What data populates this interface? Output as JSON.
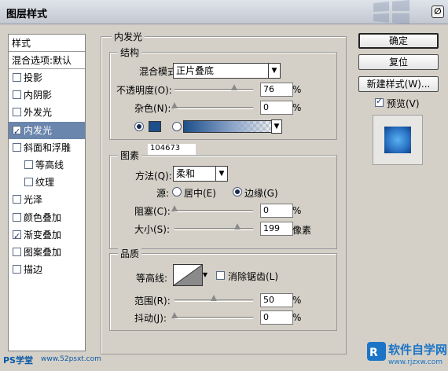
{
  "window": {
    "title": "图层样式",
    "close_glyph": "∅"
  },
  "style_list": {
    "header": "样式",
    "blend_options": "混合选项:默认",
    "items": [
      {
        "label": "投影",
        "checked": false,
        "indent": false,
        "selected": false
      },
      {
        "label": "内阴影",
        "checked": false,
        "indent": false,
        "selected": false
      },
      {
        "label": "外发光",
        "checked": false,
        "indent": false,
        "selected": false
      },
      {
        "label": "内发光",
        "checked": true,
        "indent": false,
        "selected": true
      },
      {
        "label": "斜面和浮雕",
        "checked": false,
        "indent": false,
        "selected": false
      },
      {
        "label": "等高线",
        "checked": false,
        "indent": true,
        "selected": false
      },
      {
        "label": "纹理",
        "checked": false,
        "indent": true,
        "selected": false
      },
      {
        "label": "光泽",
        "checked": false,
        "indent": false,
        "selected": false
      },
      {
        "label": "颜色叠加",
        "checked": false,
        "indent": false,
        "selected": false
      },
      {
        "label": "渐变叠加",
        "checked": true,
        "indent": false,
        "selected": false
      },
      {
        "label": "图案叠加",
        "checked": false,
        "indent": false,
        "selected": false
      },
      {
        "label": "描边",
        "checked": false,
        "indent": false,
        "selected": false
      }
    ]
  },
  "inner_glow": {
    "title": "内发光",
    "structure": {
      "title": "结构",
      "blend_mode_label": "混合模式:",
      "blend_mode_value": "正片叠底",
      "opacity_label": "不透明度(O):",
      "opacity_value": "76",
      "opacity_level": 0.76,
      "noise_label": "杂色(N):",
      "noise_value": "0",
      "noise_level": 0,
      "percent": "%",
      "color": "#1d4f8a"
    },
    "elements": {
      "title": "图素",
      "watermark_id": "104673",
      "technique_label": "方法(Q):",
      "technique_value": "柔和",
      "source_label": "源:",
      "source_center": "居中(E)",
      "source_edge": "边缘(G)",
      "choke_label": "阻塞(C):",
      "choke_value": "0",
      "choke_level": 0,
      "size_label": "大小(S):",
      "size_value": "199",
      "size_level": 0.8,
      "px_unit": "像素",
      "percent": "%"
    },
    "quality": {
      "title": "品质",
      "contour_label": "等高线:",
      "antialias_label": "消除锯齿(L)",
      "range_label": "范围(R):",
      "range_value": "50",
      "range_level": 0.5,
      "jitter_label": "抖动(J):",
      "jitter_value": "0",
      "jitter_level": 0,
      "percent": "%"
    }
  },
  "buttons": {
    "ok": "确定",
    "reset": "复位",
    "new_style": "新建样式(W)...",
    "preview_label": "预览(V)"
  },
  "watermarks": {
    "left": "PS学堂",
    "left_url": "www.52psxt.com",
    "right": "软件自学网",
    "right_url": "www.rjzxw.com"
  }
}
